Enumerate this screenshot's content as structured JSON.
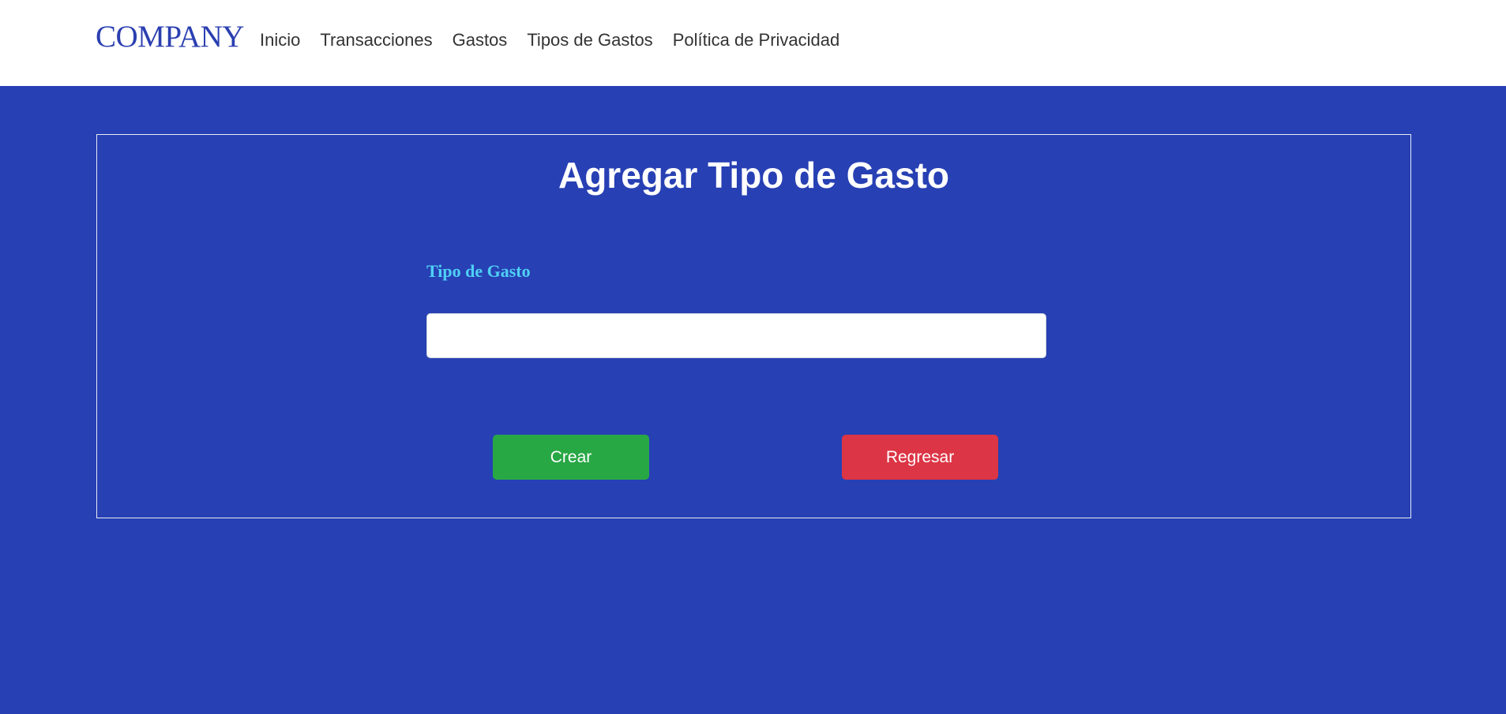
{
  "navbar": {
    "brand": "COMPANY",
    "links": [
      {
        "label": "Inicio"
      },
      {
        "label": "Transacciones"
      },
      {
        "label": "Gastos"
      },
      {
        "label": "Tipos de Gastos"
      },
      {
        "label": "Política de Privacidad"
      }
    ]
  },
  "form": {
    "title": "Agregar Tipo de Gasto",
    "field_label": "Tipo de Gasto",
    "field_value": "",
    "create_label": "Crear",
    "back_label": "Regresar"
  },
  "colors": {
    "page_background": "#2740b4",
    "brand": "#2a3fb0",
    "label_accent": "#4fd0f5",
    "create_button": "#28a745",
    "back_button": "#dc3545"
  }
}
